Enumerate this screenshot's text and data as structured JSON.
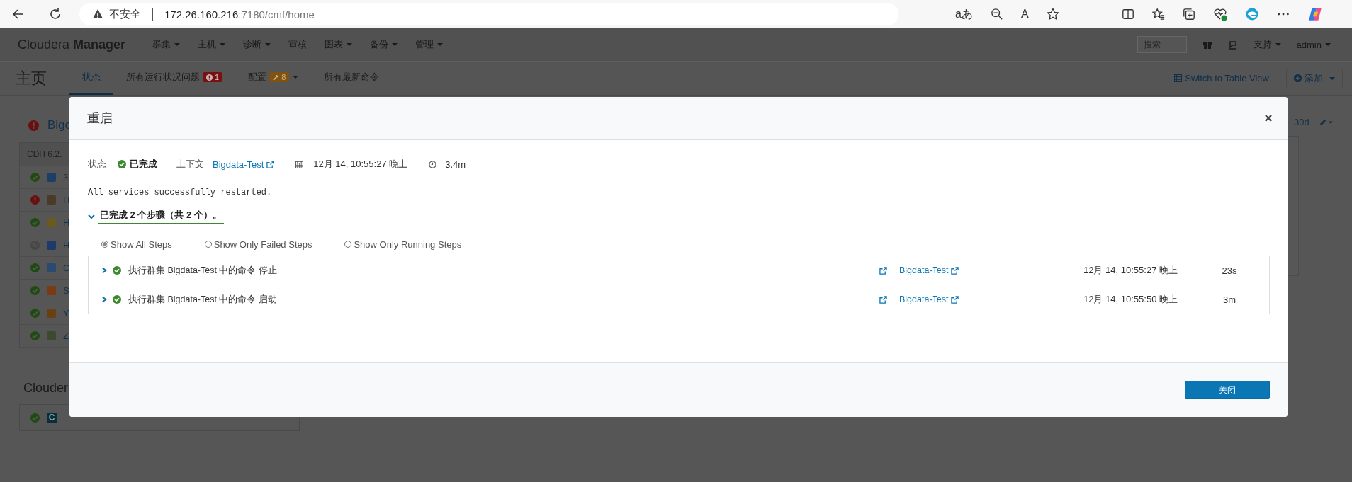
{
  "browser": {
    "security_label": "不安全",
    "url_host": "172.26.160.216",
    "url_rest": ":7180/cmf/home",
    "translate_glyph": "aあ",
    "read_aloud_glyph": "A"
  },
  "app": {
    "brand_light": "Cloudera",
    "brand_bold": "Manager",
    "menu": [
      {
        "label": "群集",
        "dropdown": true
      },
      {
        "label": "主机",
        "dropdown": true
      },
      {
        "label": "诊断",
        "dropdown": true
      },
      {
        "label": "审核",
        "dropdown": false
      },
      {
        "label": "图表",
        "dropdown": true
      },
      {
        "label": "备份",
        "dropdown": true
      },
      {
        "label": "管理",
        "dropdown": true
      }
    ],
    "search": {
      "placeholder": "搜索"
    },
    "support": "支持",
    "user": "admin"
  },
  "subnav": {
    "title": "主页",
    "tabs": [
      {
        "label": "状态",
        "selected": true
      },
      {
        "label": "所有运行状况问题",
        "selected": false,
        "badge": {
          "kind": "error",
          "text": "1"
        },
        "dropdown": false
      },
      {
        "label": "配置",
        "selected": false,
        "badge": {
          "kind": "warning",
          "text": "8"
        },
        "dropdown": true
      },
      {
        "label": "所有最新命令",
        "selected": false
      }
    ],
    "table_view_link": "Switch to Table View",
    "add_button": "添加"
  },
  "background": {
    "cluster": {
      "kind": "bad",
      "title": "Bigc"
    },
    "version": "CDH 6.2.",
    "services": [
      {
        "kind": "good",
        "color": "#1d3f66",
        "initial": "3"
      },
      {
        "kind": "bad",
        "color": "#4a3a26",
        "initial": "H"
      },
      {
        "kind": "good",
        "color": "#6a5a1e",
        "initial": "H"
      },
      {
        "kind": "disabled",
        "color": "#1e3a6a",
        "initial": "H"
      },
      {
        "kind": "good",
        "color": "#2a4a70",
        "initial": "C"
      },
      {
        "kind": "good",
        "color": "#7a3a14",
        "initial": "S"
      },
      {
        "kind": "good",
        "color": "#6a4010",
        "initial": "Y"
      },
      {
        "kind": "good",
        "color": "#3d4a30",
        "initial": "Z"
      }
    ],
    "section_title": "Clouder",
    "mgmt_service": {
      "kind": "good",
      "icon_letter": "C"
    },
    "range": "30d"
  },
  "modal": {
    "title": "重启",
    "status_label": "状态",
    "status": {
      "kind": "success",
      "value": "已完成"
    },
    "context_label": "上下文",
    "context_link": "Bigdata-Test",
    "started": "12月 14, 10:55:27 晚上",
    "duration": "3.4m",
    "message": "All services successfully restarted.",
    "steps_expanded": true,
    "steps_summary": "已完成 2 个步骤（共 2 个）。",
    "filters": [
      {
        "label": "Show All Steps",
        "selected": true
      },
      {
        "label": "Show Only Failed Steps",
        "selected": false
      },
      {
        "label": "Show Only Running Steps",
        "selected": false
      }
    ],
    "steps": [
      {
        "expanded": false,
        "kind": "success",
        "description": "执行群集 Bigdata-Test 中的命令 停止",
        "context_link": "Bigdata-Test",
        "time": "12月 14, 10:55:27 晚上",
        "duration": "23s"
      },
      {
        "expanded": false,
        "kind": "success",
        "description": "执行群集 Bigdata-Test 中的命令 启动",
        "context_link": "Bigdata-Test",
        "time": "12月 14, 10:55:50 晚上",
        "duration": "3m"
      }
    ],
    "close_button": "关闭"
  }
}
